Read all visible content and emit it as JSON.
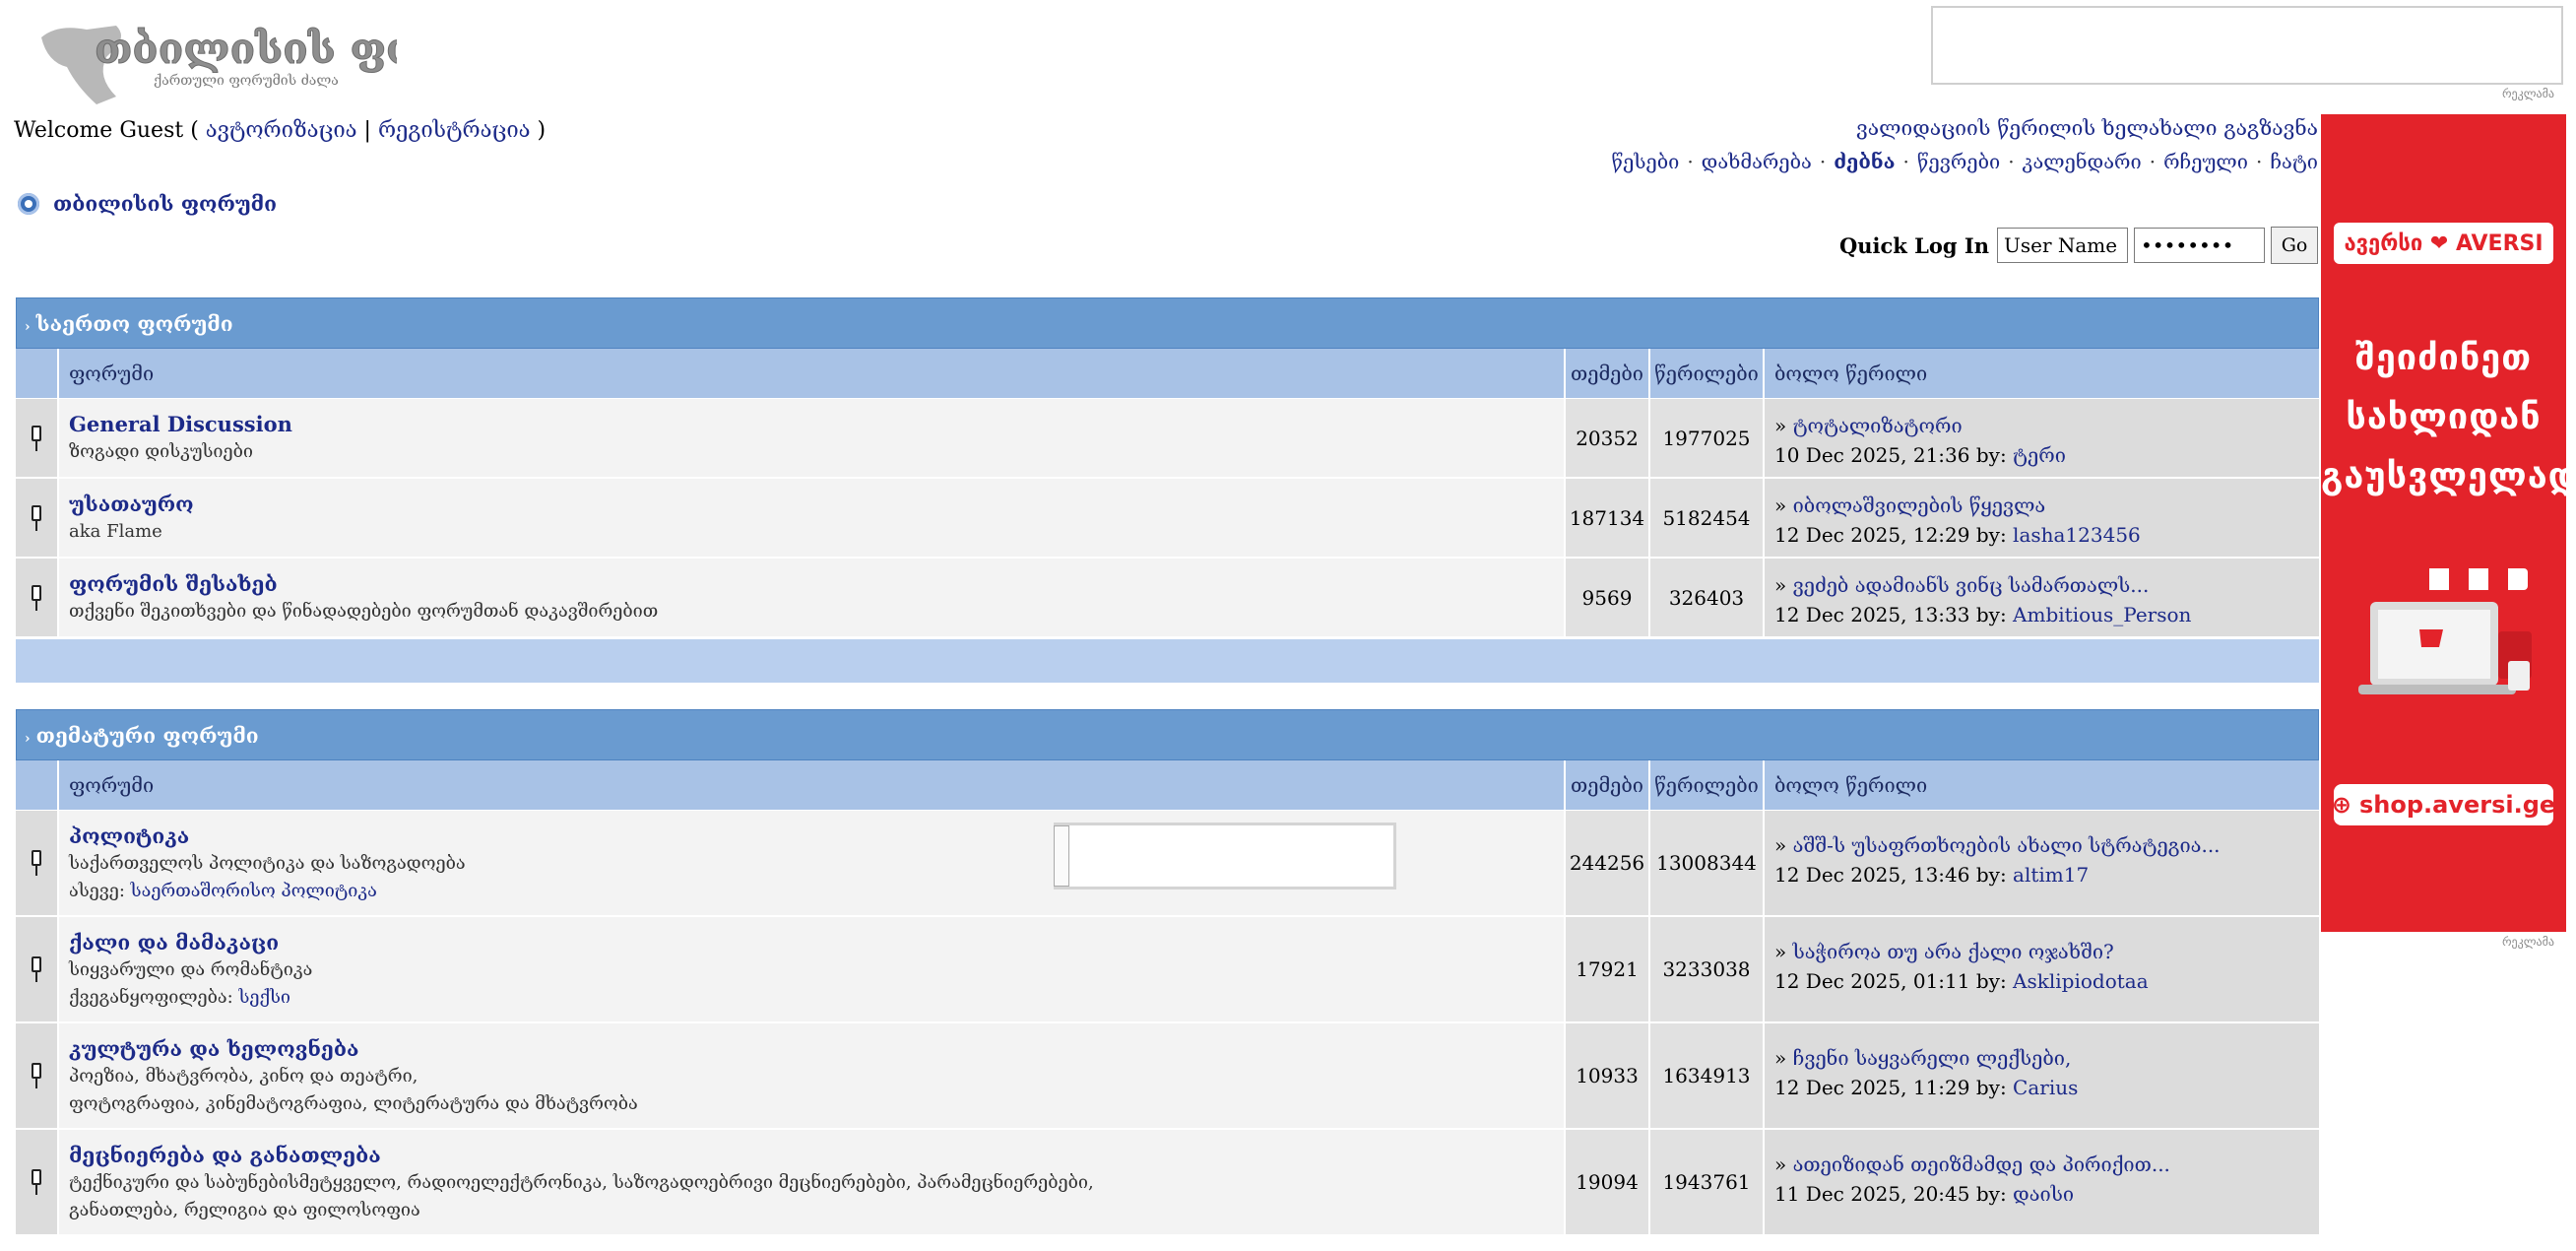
{
  "header": {
    "logo_title": "თბილისის ფორუმი",
    "logo_subtitle": "ქართული ფორუმის ძალა",
    "welcome_prefix": "Welcome Guest ( ",
    "login_link": "ავტორიზაცია",
    "separator": " | ",
    "register_link": "რეგისტრაცია",
    "welcome_suffix": " )",
    "validation_link": "ვალიდაციის წერილის ხელახალი გაგზავნა",
    "nav": [
      "წესები",
      "დახმარება",
      "ძებნა",
      "წევრები",
      "კალენდარი",
      "რჩეული",
      "ჩატი"
    ],
    "breadcrumb": "თბილისის ფორუმი",
    "ad_tag": "რეკლამა"
  },
  "quick_login": {
    "label": "Quick Log In",
    "username_value": "User Name",
    "password_value": "••••••••",
    "go_label": "Go"
  },
  "side_ad": {
    "brand": "ავერსი ❤ AVERSI",
    "slogan": [
      "შეიძინეთ",
      "სახლიდან",
      "გაუსვლელად"
    ],
    "shop": "shop.aversi.ge",
    "brand_color": "#e3232a"
  },
  "columns": {
    "forum": "ფორუმი",
    "topics": "თემები",
    "posts": "წერილები",
    "last_post": "ბოლო წერილი"
  },
  "categories": [
    {
      "title": "საერთო ფორუმი",
      "forums": [
        {
          "title": "General Discussion",
          "desc": "ზოგადი დისკუსიები",
          "topics": "20352",
          "posts": "1977025",
          "last_title": "ტოტალიზატორი",
          "last_date": "10 Dec 2025, 21:36 by: ",
          "last_user": "ტერი"
        },
        {
          "title": "უსათაურო",
          "desc": "aka Flame",
          "topics": "187134",
          "posts": "5182454",
          "last_title": "იბოლაშვილების წყევლა",
          "last_date": "12 Dec 2025, 12:29 by: ",
          "last_user": "lasha123456"
        },
        {
          "title": "ფორუმის შესახებ",
          "desc": "თქვენი შეკითხვები და წინადადებები ფორუმთან დაკავშირებით",
          "topics": "9569",
          "posts": "326403",
          "last_title": "ვეძებ ადამიანს ვინც სამართალს...",
          "last_date": "12 Dec 2025, 13:33 by: ",
          "last_user": "Ambitious_Person"
        }
      ]
    },
    {
      "title": "თემატური ფორუმი",
      "forums": [
        {
          "title": "პოლიტიკა",
          "desc": "საქართველოს პოლიტიკა და საზოგადოება",
          "sub_label": "ასევე: ",
          "sub_link": "საერთაშორისო პოლიტიკა",
          "topics": "244256",
          "posts": "13008344",
          "last_title": "აშშ-ს უსაფრთხოების ახალი სტრატეგია...",
          "last_date": "12 Dec 2025, 13:46 by: ",
          "last_user": "altim17"
        },
        {
          "title": "ქალი და მამაკაცი",
          "desc": "სიყვარული და რომანტიკა",
          "sub_label": "ქვეგანყოფილება: ",
          "sub_link": "სექსი",
          "topics": "17921",
          "posts": "3233038",
          "last_title": "საჭიროა თუ არა ქალი ოჯახში?",
          "last_date": "12 Dec 2025, 01:11 by: ",
          "last_user": "Asklipiodotaa"
        },
        {
          "title": "კულტურა და ხელოვნება",
          "desc": "პოეზია, მხატვრობა, კინო და თეატრი,",
          "desc2": "ფოტოგრაფია, კინემატოგრაფია, ლიტერატურა და მხატვრობა",
          "topics": "10933",
          "posts": "1634913",
          "last_title": "ჩვენი საყვარელი ლექსები,",
          "last_date": "12 Dec 2025, 11:29 by: ",
          "last_user": "Carius"
        },
        {
          "title": "მეცნიერება და განათლება",
          "desc": "ტექნიკური და საბუნებისმეტყველო, რადიოელექტრონიკა, საზოგადოებრივი მეცნიერებები, პარამეცნიერებები,",
          "desc2": "განათლება, რელიგია და ფილოსოფია",
          "topics": "19094",
          "posts": "1943761",
          "last_title": "ათეიზიდან თეიზმამდე და პირიქით...",
          "last_date": "11 Dec 2025, 20:45 by: ",
          "last_user": "დაისი"
        }
      ]
    }
  ]
}
